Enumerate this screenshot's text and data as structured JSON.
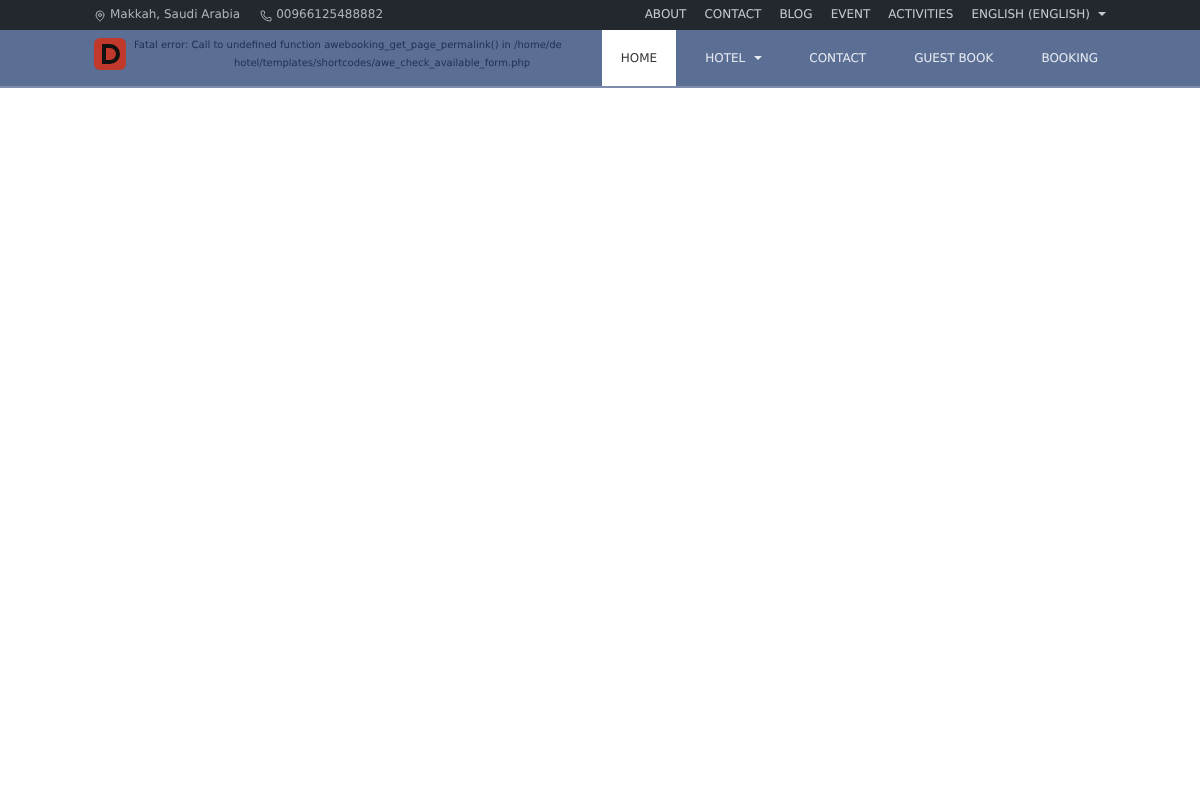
{
  "topbar": {
    "location": "Makkah, Saudi Arabia",
    "phone": "00966125488882",
    "links": [
      "ABOUT",
      "CONTACT",
      "BLOG",
      "EVENT",
      "ACTIVITIES"
    ],
    "language": "ENGLISH (ENGLISH)"
  },
  "error": {
    "line1": "Fatal error: Call to undefined function awebooking_get_page_permalink() in /home/de",
    "line2": "hotel/templates/shortcodes/awe_check_available_form.php"
  },
  "nav": [
    {
      "label": "HOME",
      "selected": true,
      "dropdown": false
    },
    {
      "label": "HOTEL",
      "selected": false,
      "dropdown": true
    },
    {
      "label": "CONTACT",
      "selected": false,
      "dropdown": false
    },
    {
      "label": "GUEST BOOK",
      "selected": false,
      "dropdown": false
    },
    {
      "label": "BOOKING",
      "selected": false,
      "dropdown": false
    }
  ]
}
